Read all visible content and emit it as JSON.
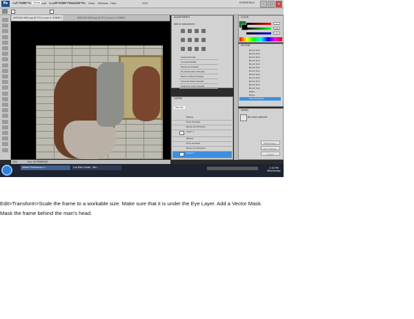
{
  "app": {
    "logo": "Ps",
    "menu": [
      "File",
      "Edit",
      "Image",
      "Layer",
      "Select",
      "Filter",
      "Analysis",
      "3D",
      "View",
      "Window",
      "Help"
    ],
    "zoom_menu": "25%",
    "workspace": "ESSENTIALS"
  },
  "options_bar": {
    "auto_select_label": "Auto-Select:",
    "auto_select_value": "Group",
    "show_transform_label": "Show Transform Controls"
  },
  "document": {
    "tab_active": "AMSCAN 9600.jpg @ 25% (Layer 5, RGB/8*)",
    "tab_inactive": "AMSCAN 9600.jpg @ 25% (Layer 5, RGB/8*)",
    "zoom_status": "25%",
    "doc_status": "Doc: 60.9M/86.6M"
  },
  "adjustments_panel": {
    "tab": "ADJUSTMENTS",
    "title": "Add an adjustment",
    "presets": [
      "Levels Presets",
      "Curves Presets",
      "Exposure Presets",
      "Hue/Saturation Presets",
      "Black & White Presets",
      "Channel Mixer Presets",
      "Selective Color Presets"
    ]
  },
  "layers_panel": {
    "tab": "LAYERS",
    "blend_mode": "Normal",
    "rows": [
      "Effects",
      "Drop Shadow",
      "Bevel and Emboss",
      "Layer 1",
      "Effects",
      "Drop Shadow",
      "Bevel and Emboss",
      "Layer 5"
    ]
  },
  "color_panel": {
    "tab": "COLOR",
    "values": [
      "0",
      "255",
      "0"
    ]
  },
  "history_panel": {
    "tab": "HISTORY",
    "items": [
      "Brush Tool",
      "Brush Tool",
      "Brush Tool",
      "Brush Tool",
      "Brush Tool",
      "Brush Tool",
      "Brush Tool",
      "Brush Tool",
      "Brush Tool",
      "Brush Tool",
      "Brush Tool",
      "Brush Tool",
      "Paste",
      "Move",
      "Free Transform"
    ]
  },
  "masks_panel": {
    "tab": "MASKS",
    "status": "No mask selected",
    "buttons": [
      "Mask Edge...",
      "Color Range...",
      "Invert"
    ]
  },
  "taskbar": {
    "start": "Start",
    "tasks": [
      "Adobe Photoshop C...",
      "Cut Man Guide - Mic..."
    ],
    "time": "2:35 PM",
    "day": "Wednesday"
  },
  "caption": "Edit>Transform>Scale the frame to a workable size. Make sure that it is under the Eye Layer. Add a Vector Mask. Mask the frame behind the man's head.",
  "colors": {
    "highlight": "#3c8fe0",
    "taskbar": "#1d2330",
    "menubar": "#d6d6d6"
  }
}
